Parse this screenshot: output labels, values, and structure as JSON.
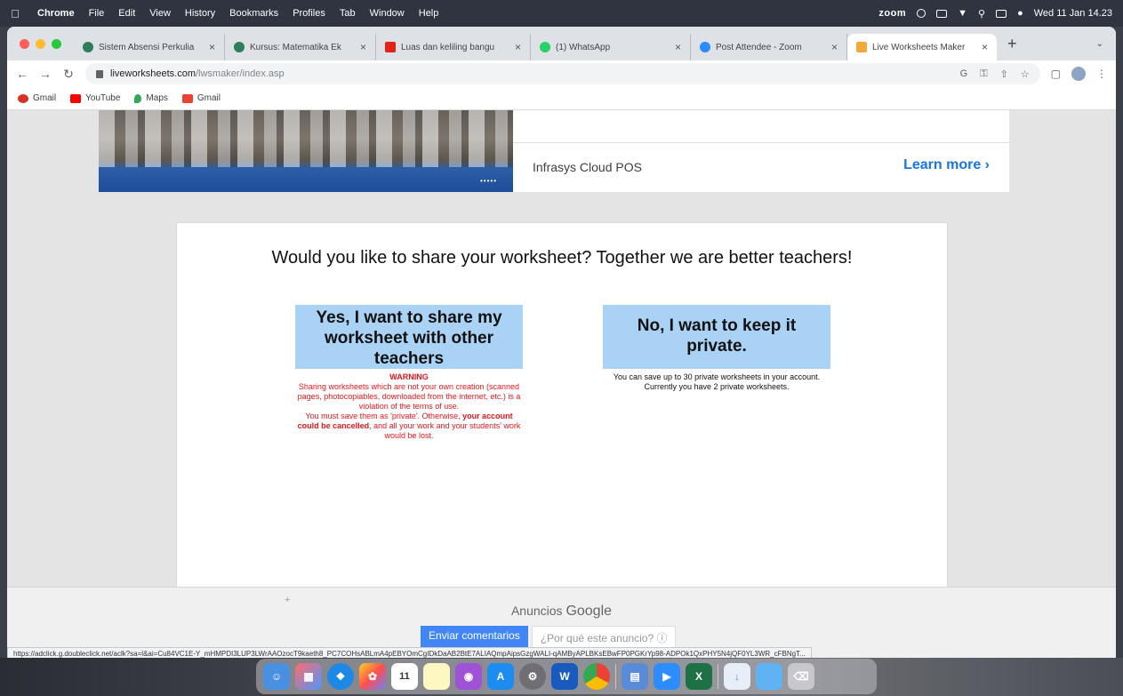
{
  "menubar": {
    "app": "Chrome",
    "items": [
      "File",
      "Edit",
      "View",
      "History",
      "Bookmarks",
      "Profiles",
      "Tab",
      "Window",
      "Help"
    ],
    "zoom": "zoom",
    "clock": "Wed 11 Jan 14.23"
  },
  "tabs": [
    {
      "label": "Sistem Absensi Perkulia",
      "color": "#2e7d5b"
    },
    {
      "label": "Kursus: Matematika Ek",
      "color": "#2e7d5b"
    },
    {
      "label": "Luas dan keliling bangu",
      "color": "#e62117"
    },
    {
      "label": "(1) WhatsApp",
      "color": "#25d366"
    },
    {
      "label": "Post Attendee - Zoom",
      "color": "#2d8cff"
    },
    {
      "label": "Live Worksheets Maker",
      "color": "#f4a83a"
    }
  ],
  "toolbar": {
    "url_host": "liveworksheets.com",
    "url_path": "/lwsmaker/index.asp"
  },
  "bookmarks": [
    {
      "label": "Gmail",
      "color": "#d93025"
    },
    {
      "label": "YouTube",
      "color": "#ff0000"
    },
    {
      "label": "Maps",
      "color": "#34a853"
    },
    {
      "label": "Gmail",
      "color": "#ea4335"
    }
  ],
  "ad_top": {
    "name": "Infrasys Cloud POS",
    "learn_more": "Learn more"
  },
  "share": {
    "question": "Would you like to share your worksheet? Together we are better teachers!",
    "yes_label": "Yes, I want to share my worksheet with other teachers",
    "warning_title": "WARNING",
    "warning_text1": "Sharing worksheets which are not your own creation (scanned pages, photocopiables, downloaded from the internet, etc.) is a violation of the terms of use.",
    "warning_text2a": "You must save them as 'private'. Otherwise, ",
    "warning_bold": "your account could be cancelled",
    "warning_text2b": ", and all your work and your students' work would be lost.",
    "no_label": "No, I want to keep it private.",
    "private_note1": "You can save up to 30 private worksheets in your account.",
    "private_note2": "Currently you have 2 private worksheets."
  },
  "anchor_ad": {
    "title": "Anuncios",
    "brand": "Google",
    "feedback": "Enviar comentarios",
    "why": "¿Por qué este anuncio? ⓘ"
  },
  "status_url": "https://adclick.g.doubleclick.net/aclk?sa=l&ai=Cu84VC1E-Y_mHMPDI3LUP3LWrAAOzocT9kaeth8_PC7COHsABLmA4pEBYOmCgIDkDaAB2BtE7ALIAQmpAipsGzgWALI-qAMByAPLBKsEBwFP0PGKrYp98-ADPOk1QxPHY5N4jQF0YL3WR_cFBNgT..."
}
